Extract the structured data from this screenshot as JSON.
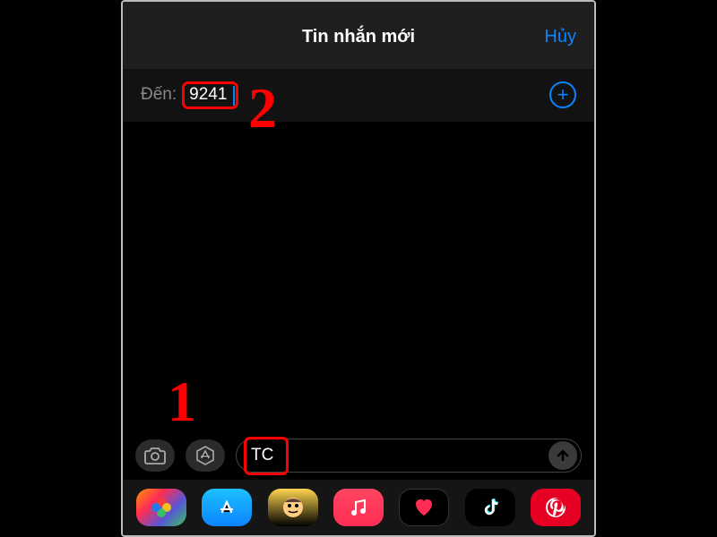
{
  "header": {
    "title": "Tin nhắn mới",
    "cancel": "Hủy"
  },
  "recipient": {
    "to_label": "Đến:",
    "value": "9241"
  },
  "compose": {
    "input_value": "TC"
  },
  "annotations": {
    "step1": "1",
    "step2": "2"
  },
  "app_strip": {
    "items": [
      "photos",
      "appstore",
      "memoji",
      "music",
      "fitness",
      "tiktok",
      "pinterest"
    ]
  }
}
